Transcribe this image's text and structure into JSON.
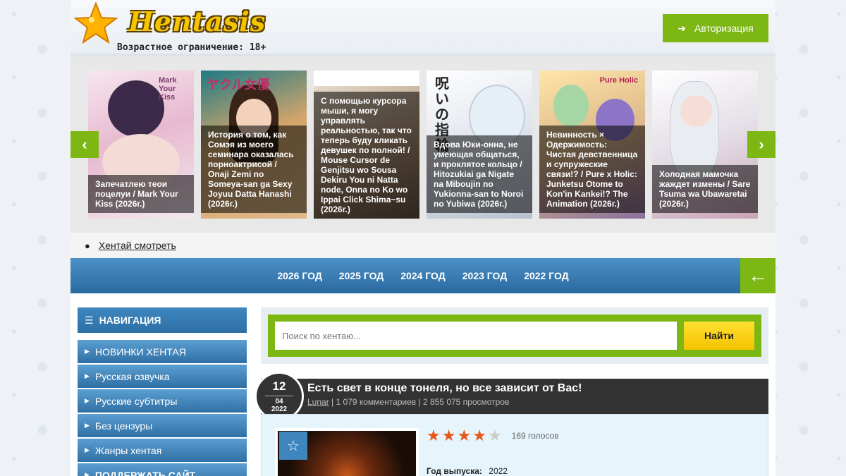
{
  "header": {
    "logo_text": "Hentasis",
    "age_text": "Возрастное ограничение: 18+",
    "auth_label": "Авторизация"
  },
  "carousel": {
    "slides": [
      {
        "caption": "Запечатлею теои поцелуи / Mark Your Kiss (2026г.)",
        "cover_text": "Mark Your Kiss",
        "bg": "#f2d9e8"
      },
      {
        "caption": "История о том, как Сомэя из моего семинара оказалась порноактрисой / Onaji Zemi no Someya-san ga Sexy Joyuu Datta Hanashi (2026г.)",
        "cover_text": "ヤクル女優",
        "bg": "#d9a76a"
      },
      {
        "caption": "С помощью курсора мыши, я могу управлять реальностью, так что теперь буду кликать девушек по полной! / Mouse Cursor de Genjitsu wo Sousa Dekiru You ni Natta node, Onna no Ko wo Ippai Click Shima~su (2026г.)",
        "cover_text": "",
        "bg": "#c9b59a"
      },
      {
        "caption": "Вдова Юки-онна, не умеющая общаться, и проклятое кольцо / Hitozukiai ga Nigate na Miboujin no Yukionna-san to Noroi no Yubiwa (2026г.)",
        "cover_text": "呪いの指輪",
        "bg": "#dde2ea"
      },
      {
        "caption": "Невинность × Одержимость: Чистая девственница и супружеские связи!? / Pure x Holic: Junketsu Otome to Kon'in Kankei!? The Animation (2026г.)",
        "cover_text": "Pure Holic",
        "bg": "#e6c79a"
      },
      {
        "caption": "Холодная мамочка жаждет измены / Sare Tsuma wa Ubawaretai (2026г.)",
        "cover_text": "",
        "bg": "#e4dde6"
      }
    ]
  },
  "breadcrumb": {
    "label": "Хентай смотреть"
  },
  "years": [
    "2026 ГОД",
    "2025 ГОД",
    "2024 ГОД",
    "2023 ГОД",
    "2022 ГОД"
  ],
  "sidebar": {
    "title": "НАВИГАЦИЯ",
    "items": [
      "НОВИНКИ ХЕНТАЯ",
      "Русская озвучка",
      "Русские субтитры",
      "Без цензуры",
      "Жанры хентая",
      "ПОДДЕРЖАТЬ САЙТ"
    ]
  },
  "search": {
    "placeholder": "Поиск по хентаю...",
    "button": "Найти"
  },
  "article": {
    "day": "12",
    "month": "04",
    "year": "2022",
    "title": "Есть свет в конце тонеля, но все зависит от Вас!",
    "author": "Lunar",
    "meta_rest": " | 1 079 комментариев | 2 855 075 просмотров",
    "rating": 4,
    "rating_max": 5,
    "votes": "169 голосов",
    "year_label": "Год выпуска:",
    "year_value": "2022"
  },
  "colors": {
    "accent_green": "#7db713",
    "nav_blue": "#2d6fa5",
    "star_orange": "#e7561b",
    "search_yellow": "#f4c300"
  }
}
